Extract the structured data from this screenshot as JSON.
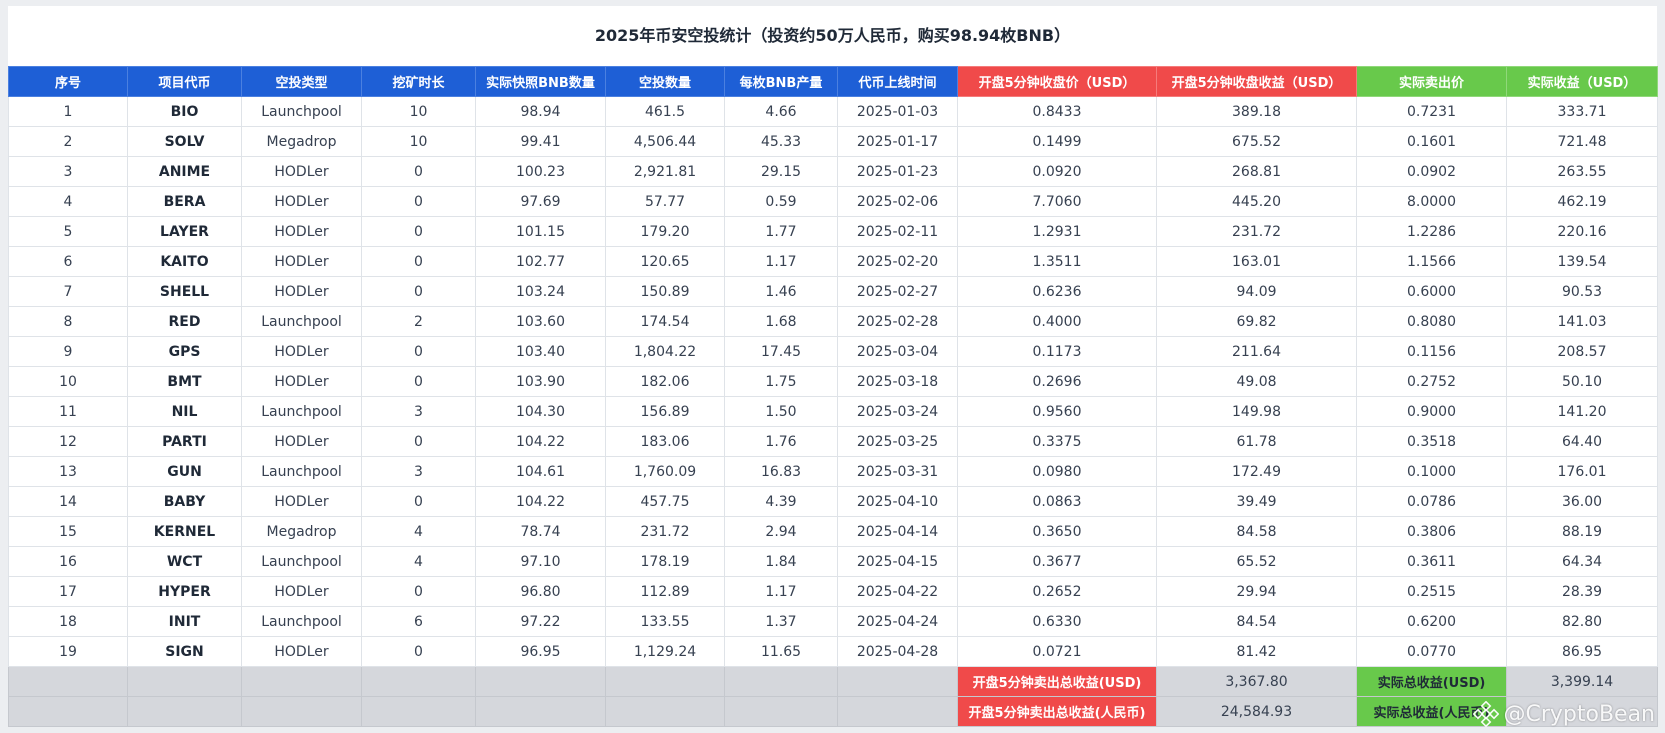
{
  "title": "2025年币安空投统计（投资约50万人民币，购买98.94枚BNB）",
  "headers": [
    "序号",
    "项目代币",
    "空投类型",
    "挖矿时长",
    "实际快照BNB数量",
    "空投数量",
    "每枚BNB产量",
    "代币上线时间",
    "开盘5分钟收盘价（USD）",
    "开盘5分钟收盘收益（USD）",
    "实际卖出价",
    "实际收益（USD）"
  ],
  "rows": [
    [
      "1",
      "BIO",
      "Launchpool",
      "10",
      "98.94",
      "461.5",
      "4.66",
      "2025-01-03",
      "0.8433",
      "389.18",
      "0.7231",
      "333.71"
    ],
    [
      "2",
      "SOLV",
      "Megadrop",
      "10",
      "99.41",
      "4,506.44",
      "45.33",
      "2025-01-17",
      "0.1499",
      "675.52",
      "0.1601",
      "721.48"
    ],
    [
      "3",
      "ANIME",
      "HODLer",
      "0",
      "100.23",
      "2,921.81",
      "29.15",
      "2025-01-23",
      "0.0920",
      "268.81",
      "0.0902",
      "263.55"
    ],
    [
      "4",
      "BERA",
      "HODLer",
      "0",
      "97.69",
      "57.77",
      "0.59",
      "2025-02-06",
      "7.7060",
      "445.20",
      "8.0000",
      "462.19"
    ],
    [
      "5",
      "LAYER",
      "HODLer",
      "0",
      "101.15",
      "179.20",
      "1.77",
      "2025-02-11",
      "1.2931",
      "231.72",
      "1.2286",
      "220.16"
    ],
    [
      "6",
      "KAITO",
      "HODLer",
      "0",
      "102.77",
      "120.65",
      "1.17",
      "2025-02-20",
      "1.3511",
      "163.01",
      "1.1566",
      "139.54"
    ],
    [
      "7",
      "SHELL",
      "HODLer",
      "0",
      "103.24",
      "150.89",
      "1.46",
      "2025-02-27",
      "0.6236",
      "94.09",
      "0.6000",
      "90.53"
    ],
    [
      "8",
      "RED",
      "Launchpool",
      "2",
      "103.60",
      "174.54",
      "1.68",
      "2025-02-28",
      "0.4000",
      "69.82",
      "0.8080",
      "141.03"
    ],
    [
      "9",
      "GPS",
      "HODLer",
      "0",
      "103.40",
      "1,804.22",
      "17.45",
      "2025-03-04",
      "0.1173",
      "211.64",
      "0.1156",
      "208.57"
    ],
    [
      "10",
      "BMT",
      "HODLer",
      "0",
      "103.90",
      "182.06",
      "1.75",
      "2025-03-18",
      "0.2696",
      "49.08",
      "0.2752",
      "50.10"
    ],
    [
      "11",
      "NIL",
      "Launchpool",
      "3",
      "104.30",
      "156.89",
      "1.50",
      "2025-03-24",
      "0.9560",
      "149.98",
      "0.9000",
      "141.20"
    ],
    [
      "12",
      "PARTI",
      "HODLer",
      "0",
      "104.22",
      "183.06",
      "1.76",
      "2025-03-25",
      "0.3375",
      "61.78",
      "0.3518",
      "64.40"
    ],
    [
      "13",
      "GUN",
      "Launchpool",
      "3",
      "104.61",
      "1,760.09",
      "16.83",
      "2025-03-31",
      "0.0980",
      "172.49",
      "0.1000",
      "176.01"
    ],
    [
      "14",
      "BABY",
      "HODLer",
      "0",
      "104.22",
      "457.75",
      "4.39",
      "2025-04-10",
      "0.0863",
      "39.49",
      "0.0786",
      "36.00"
    ],
    [
      "15",
      "KERNEL",
      "Megadrop",
      "4",
      "78.74",
      "231.72",
      "2.94",
      "2025-04-14",
      "0.3650",
      "84.58",
      "0.3806",
      "88.19"
    ],
    [
      "16",
      "WCT",
      "Launchpool",
      "4",
      "97.10",
      "178.19",
      "1.84",
      "2025-04-15",
      "0.3677",
      "65.52",
      "0.3611",
      "64.34"
    ],
    [
      "17",
      "HYPER",
      "HODLer",
      "0",
      "96.80",
      "112.89",
      "1.17",
      "2025-04-22",
      "0.2652",
      "29.94",
      "0.2515",
      "28.39"
    ],
    [
      "18",
      "INIT",
      "Launchpool",
      "6",
      "97.22",
      "133.55",
      "1.37",
      "2025-04-24",
      "0.6330",
      "84.54",
      "0.6200",
      "82.80"
    ],
    [
      "19",
      "SIGN",
      "HODLer",
      "0",
      "96.95",
      "1,129.24",
      "11.65",
      "2025-04-28",
      "0.0721",
      "81.42",
      "0.0770",
      "86.95"
    ]
  ],
  "totals": {
    "open5_usd_label": "开盘5分钟卖出总收益(USD)",
    "open5_usd_value": "3,367.80",
    "actual_usd_label": "实际总收益(USD)",
    "actual_usd_value": "3,399.14",
    "open5_cny_label": "开盘5分钟卖出总收益(人民币)",
    "open5_cny_value": "24,584.93",
    "actual_cny_label": "实际总收益(人民币)",
    "actual_cny_value": ""
  },
  "watermark": "@CryptoBean",
  "colors": {
    "header_blue": "#1e5fd6",
    "header_red": "#f04a4a",
    "header_green": "#68c94b",
    "footer_gray": "#d5d7dc"
  }
}
